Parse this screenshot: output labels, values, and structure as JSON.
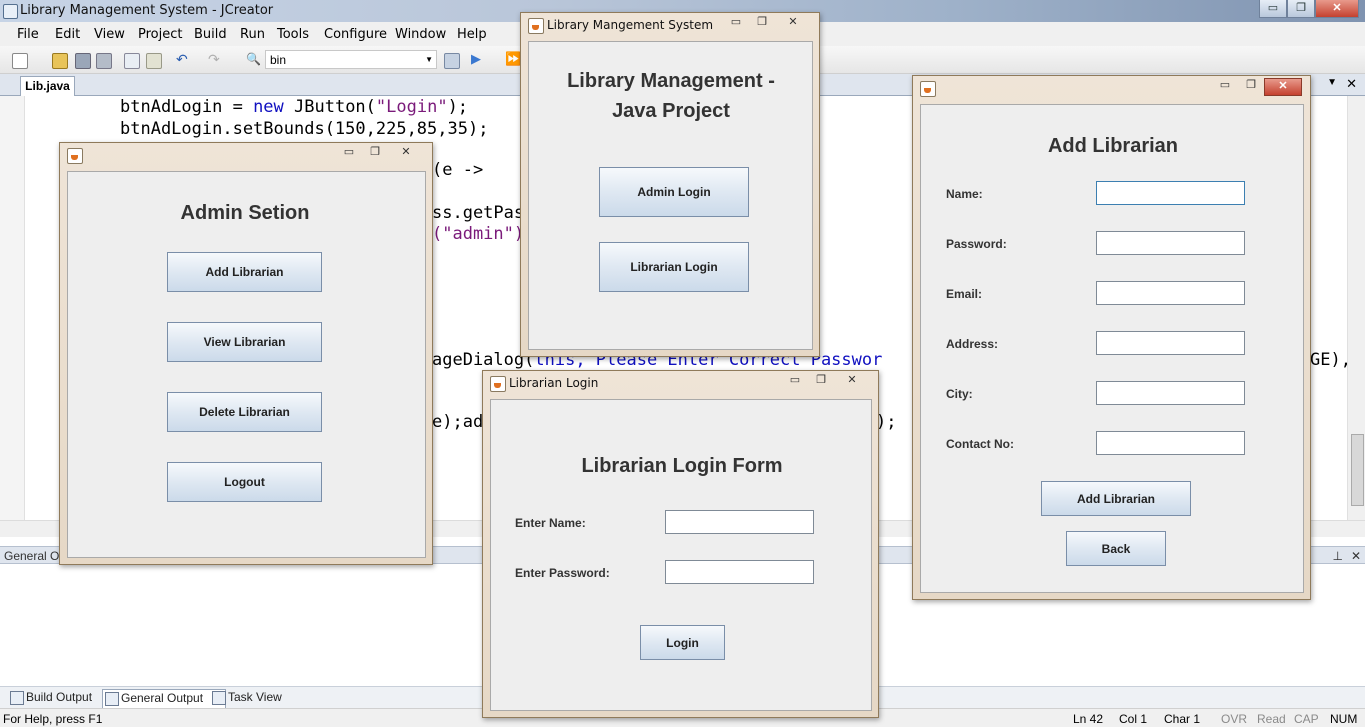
{
  "app": {
    "title": "Library Management System - JCreator",
    "menus": [
      "File",
      "Edit",
      "View",
      "Project",
      "Build",
      "Run",
      "Tools",
      "Configure",
      "Window",
      "Help"
    ],
    "config_combo": "bin",
    "file_tab": "Lib.java",
    "window_buttons": {
      "min": "▭",
      "max": "❐",
      "close": "✕"
    }
  },
  "code_lines": {
    "l1_indent": "btnAdLogin = ",
    "l1_kw": "new",
    "l1_a": " JButton(",
    "l1_str": "\"Login\"",
    "l1_b": ");",
    "l2": "btnAdLogin.setBounds(150,225,85,35);",
    "l3": "(e ->",
    "l4": "ss.getPas",
    "l5_str": "(\"admin\")",
    "l6_a": "ageDialog(",
    "l6_kw": "this",
    "l6_b": ", Please Enter Correct Passwor",
    "l6_c": "GE),",
    "l7": "e);ad",
    "l7b": ");"
  },
  "output_panel": {
    "title": "General Ou"
  },
  "bottom_tabs": [
    "Build Output",
    "General Output",
    "Task View"
  ],
  "status": {
    "help": "For Help, press F1",
    "ln": "Ln 42",
    "col": "Col 1",
    "char": "Char 1",
    "ovr": "OVR",
    "read": "Read",
    "cap": "CAP",
    "num": "NUM"
  },
  "admin_window": {
    "title": "",
    "heading": "Admin Setion",
    "buttons": [
      "Add Librarian",
      "View Librarian",
      "Delete Librarian",
      "Logout"
    ]
  },
  "main_window": {
    "title": "Library Mangement System",
    "heading_line1": "Library Management -",
    "heading_line2": "Java Project",
    "buttons": [
      "Admin Login",
      "Librarian Login"
    ]
  },
  "librarian_login_window": {
    "title": "Librarian Login",
    "heading": "Librarian Login Form",
    "name_label": "Enter Name:",
    "password_label": "Enter Password:",
    "name_value": "",
    "password_value": "",
    "login_button": "Login"
  },
  "add_librarian_window": {
    "title": "",
    "heading": "Add Librarian",
    "fields": [
      {
        "label": "Name:",
        "value": ""
      },
      {
        "label": "Password:",
        "value": ""
      },
      {
        "label": "Email:",
        "value": ""
      },
      {
        "label": "Address:",
        "value": ""
      },
      {
        "label": "City:",
        "value": ""
      },
      {
        "label": "Contact No:",
        "value": ""
      }
    ],
    "add_button": "Add Librarian",
    "back_button": "Back"
  }
}
